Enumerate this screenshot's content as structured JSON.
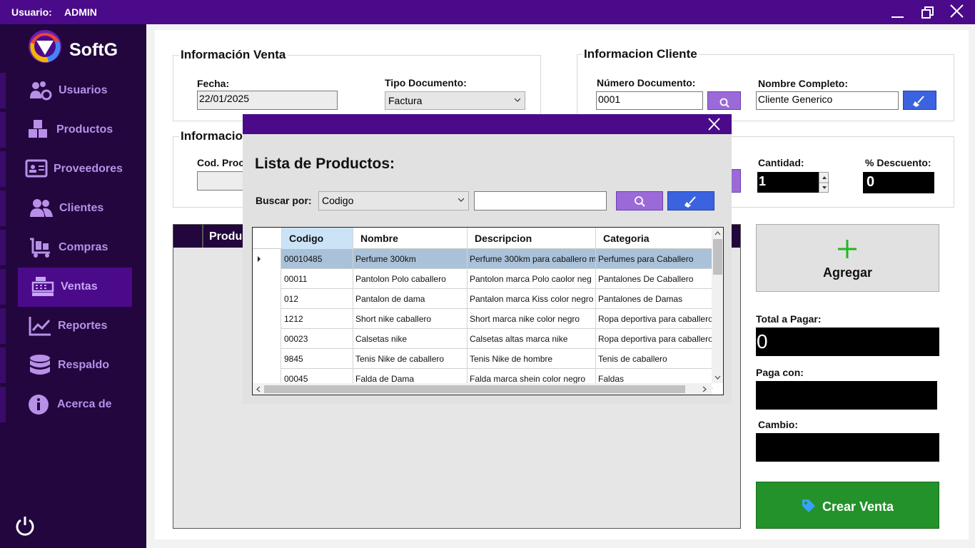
{
  "titlebar": {
    "user_label": "Usuario:",
    "user_value": "ADMIN"
  },
  "sidebar": {
    "brand": "SoftG",
    "items": [
      {
        "label": "Usuarios",
        "icon": "users-gear-icon"
      },
      {
        "label": "Productos",
        "icon": "boxes-icon"
      },
      {
        "label": "Proveedores",
        "icon": "id-card-icon"
      },
      {
        "label": "Clientes",
        "icon": "people-icon"
      },
      {
        "label": "Compras",
        "icon": "cart-icon"
      },
      {
        "label": "Ventas",
        "icon": "cash-register-icon",
        "active": true
      },
      {
        "label": "Reportes",
        "icon": "chart-line-icon"
      },
      {
        "label": "Respaldo",
        "icon": "database-icon"
      },
      {
        "label": "Acerca de",
        "icon": "info-icon"
      }
    ]
  },
  "venta": {
    "title": "Información Venta",
    "fecha_label": "Fecha:",
    "fecha_value": "22/01/2025",
    "tipo_label": "Tipo Documento:",
    "tipo_value": "Factura"
  },
  "cliente": {
    "title": "Informacion Cliente",
    "numdoc_label": "Número Documento:",
    "numdoc_value": "0001",
    "nombre_label": "Nombre Completo:",
    "nombre_value": "Cliente Generico"
  },
  "producto": {
    "title_partial": "Informacio",
    "codigo_label_partial": "Cod. Proc",
    "cantidad_label": "Cantidad:",
    "cantidad_value": "1",
    "descuento_label": "% Descuento:",
    "descuento_value": "0"
  },
  "main_grid": {
    "first_header_partial": "Produ"
  },
  "actions": {
    "agregar_label": "Agregar",
    "total_label": "Total a Pagar:",
    "total_value": "0",
    "paga_label": "Paga con:",
    "cambio_label": "Cambio:",
    "crear_label": "Crear Venta"
  },
  "modal": {
    "title": "Lista de Productos:",
    "buscar_label": "Buscar por:",
    "buscar_option": "Codigo",
    "search_value": "",
    "columns": [
      "Codigo",
      "Nombre",
      "Descripcion",
      "Categoria"
    ],
    "rows": [
      [
        "00010485",
        "Perfume 300km",
        "Perfume 300km para caballero m",
        "Perfumes para Caballero"
      ],
      [
        "00011",
        "Pantolon Polo caballero",
        "Pantolon marca Polo caolor neg",
        "Pantalones De Caballero"
      ],
      [
        "012",
        " Pantalon de dama",
        "Pantalon marca Kiss color negro",
        "Pantalones de Damas"
      ],
      [
        "1212",
        "Short nike caballero",
        "Short marca nike color negro",
        "Ropa deportiva para caballero"
      ],
      [
        "00023",
        "Calsetas nike",
        "Calsetas altas marca nike",
        "Ropa deportiva para caballero"
      ],
      [
        "9845",
        "Tenis Nike de caballero",
        "Tenis Nike de hombre",
        "Tenis de caballero"
      ],
      [
        "00045",
        "Falda de Dama",
        "Falda marca shein color negro",
        "Faldas"
      ]
    ]
  },
  "colors": {
    "titlebar": "#4b0a8a",
    "sidebar": "#22063d",
    "accent_purple": "#9b6ad8",
    "accent_blue": "#3b63e0",
    "create_green": "#23922a",
    "selected_row": "#a9c2da"
  }
}
